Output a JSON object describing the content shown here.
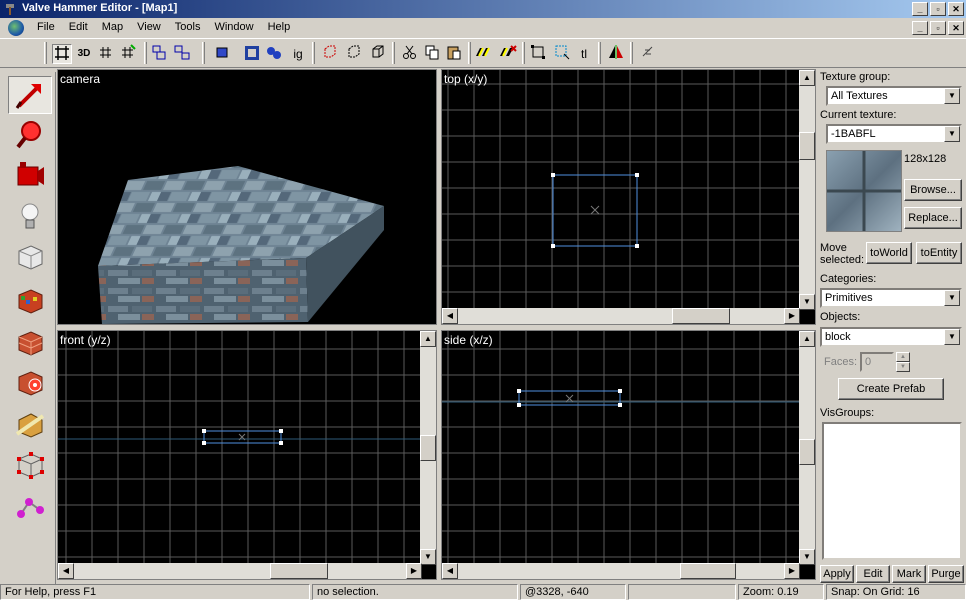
{
  "window": {
    "title": "Valve Hammer Editor - [Map1]",
    "min": "_",
    "max": "▫",
    "close": "✕"
  },
  "menu": [
    "File",
    "Edit",
    "Map",
    "View",
    "Tools",
    "Window",
    "Help"
  ],
  "toolbar": {
    "icons": [
      "grid-icon",
      "3d-grid-icon",
      "small-grid-icon",
      "large-grid-icon",
      "group-icon",
      "ungroup-icon",
      "carve-icon",
      "hollow-icon",
      "texture-lock-icon",
      "ignore-groups-icon",
      "tie-entity-icon",
      "move-to-world-icon",
      "cut-icon",
      "copy-icon",
      "paste-icon",
      "compile-icon",
      "run-icon",
      "select-box-icon",
      "toggle-selection-icon",
      "texture-lock-label",
      "flip-icon",
      "decal-icon"
    ],
    "labels": {
      "grid3d": "3D",
      "ignore_groups": "ig",
      "tl": "tl"
    }
  },
  "tools": [
    "selection-tool",
    "magnify-tool",
    "camera-tool",
    "entity-tool",
    "block-tool",
    "texture-tool",
    "apply-texture-tool",
    "decal-tool",
    "clipping-tool",
    "vertex-tool",
    "path-tool"
  ],
  "viewports": {
    "camera": {
      "label": "camera"
    },
    "top": {
      "label": "top (x/y)"
    },
    "front": {
      "label": "front (y/z)"
    },
    "side": {
      "label": "side (x/z)"
    }
  },
  "side_panel": {
    "texture_group_label": "Texture group:",
    "texture_group_value": "All Textures",
    "current_texture_label": "Current texture:",
    "current_texture_value": "-1BABFL",
    "texture_size": "128x128",
    "browse": "Browse...",
    "replace": "Replace...",
    "move_selected": [
      "Move",
      "selected:"
    ],
    "to_world": "toWorld",
    "to_entity": "toEntity",
    "categories_label": "Categories:",
    "categories_value": "Primitives",
    "objects_label": "Objects:",
    "objects_value": "block",
    "faces_label": "Faces:",
    "faces_value": "0",
    "create_prefab": "Create Prefab",
    "visgroups_label": "VisGroups:",
    "apply": "Apply",
    "edit": "Edit",
    "mark": "Mark",
    "purge": "Purge"
  },
  "status": {
    "help": "For Help, press F1",
    "selection": "no selection.",
    "coords": "@3328, -640",
    "zoom": "Zoom: 0.19",
    "snap": "Snap: On Grid: 16"
  },
  "colors": {
    "grid_line": "#5a5a5a",
    "selection_box": "#4f8fe0",
    "axis_line": "#2e5a78"
  }
}
